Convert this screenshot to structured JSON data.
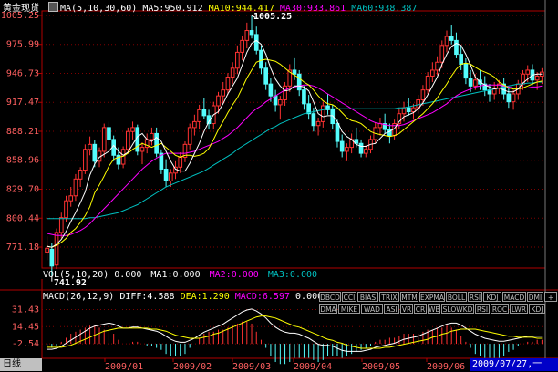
{
  "header": {
    "instrument": "黄金现货",
    "ma_params": "MA(5,10,30,60)",
    "ma5": "MA5:950.912",
    "ma10": "MA10:944.417",
    "ma30": "MA30:933.861",
    "ma60": "MA60:938.387"
  },
  "vol_header": {
    "params": "VOL(5,10,20) 0.000",
    "ma1": "MA1:0.000",
    "ma2": "MA2:0.000",
    "ma3": "MA3:0.000"
  },
  "macd_header": {
    "params": "MACD(26,12,9)",
    "diff": "DIFF:4.588",
    "dea": "DEA:1.290",
    "macd": "MACD:6.597",
    "zero": "0.000"
  },
  "indicator_buttons_row1": [
    "DBCD",
    "CCI",
    "BIAS",
    "TRIX",
    "MTM",
    "EXPMA",
    "BOLL",
    "RSI",
    "KDJ",
    "MACD",
    "DMI",
    "+"
  ],
  "indicator_buttons_row2": [
    "DMA",
    "MIKE",
    "WAD",
    "ASI",
    "VR",
    "CR",
    "WB",
    "SLOWKD",
    "RSI",
    "ROC",
    "LWR",
    "KDJ"
  ],
  "bottom": {
    "corner_label": "日线",
    "date_label": "2009/07/27,一"
  },
  "colors": {
    "up": "#ff3232",
    "down": "#54fcfc",
    "ma5": "#ffffff",
    "ma10": "#ffff00",
    "ma30": "#ff00ff",
    "ma60": "#00c0c0",
    "axis": "#b00000",
    "grid": "#800000"
  },
  "chart_data": {
    "type": "candlestick",
    "price_axis": {
      "ticks": [
        "1005.25",
        "975.99",
        "946.73",
        "917.47",
        "888.21",
        "858.96",
        "829.70",
        "800.44",
        "771.18"
      ],
      "ylim": [
        750,
        1008
      ]
    },
    "annotations": {
      "high": "1005.25",
      "low": "741.92"
    },
    "x_labels": [
      "2009/01",
      "2009/02",
      "2009/03",
      "2009/04",
      "2009/05",
      "2009/06"
    ],
    "macd_axis": {
      "ticks": [
        "31.43",
        "14.45",
        "-2.54"
      ]
    },
    "candles": [
      [
        766,
        782,
        758,
        770
      ],
      [
        769,
        775,
        742,
        752
      ],
      [
        753,
        790,
        749,
        786
      ],
      [
        786,
        806,
        780,
        801
      ],
      [
        801,
        823,
        797,
        818
      ],
      [
        818,
        832,
        812,
        823
      ],
      [
        823,
        845,
        818,
        840
      ],
      [
        840,
        852,
        832,
        849
      ],
      [
        849,
        875,
        845,
        870
      ],
      [
        870,
        883,
        864,
        875
      ],
      [
        875,
        879,
        852,
        858
      ],
      [
        858,
        872,
        852,
        868
      ],
      [
        868,
        896,
        862,
        892
      ],
      [
        892,
        898,
        874,
        880
      ],
      [
        880,
        884,
        858,
        864
      ],
      [
        864,
        872,
        850,
        855
      ],
      [
        855,
        873,
        851,
        870
      ],
      [
        870,
        892,
        866,
        888
      ],
      [
        888,
        898,
        880,
        892
      ],
      [
        892,
        895,
        864,
        868
      ],
      [
        868,
        877,
        855,
        872
      ],
      [
        872,
        886,
        866,
        880
      ],
      [
        880,
        892,
        874,
        886
      ],
      [
        886,
        892,
        862,
        866
      ],
      [
        866,
        870,
        845,
        850
      ],
      [
        850,
        860,
        832,
        838
      ],
      [
        838,
        850,
        832,
        846
      ],
      [
        846,
        858,
        840,
        852
      ],
      [
        852,
        867,
        846,
        862
      ],
      [
        862,
        878,
        857,
        875
      ],
      [
        875,
        896,
        870,
        892
      ],
      [
        892,
        905,
        884,
        898
      ],
      [
        898,
        915,
        890,
        910
      ],
      [
        910,
        922,
        901,
        904
      ],
      [
        904,
        910,
        890,
        896
      ],
      [
        896,
        918,
        890,
        914
      ],
      [
        914,
        928,
        906,
        924
      ],
      [
        924,
        938,
        916,
        930
      ],
      [
        930,
        947,
        925,
        943
      ],
      [
        943,
        958,
        936,
        952
      ],
      [
        952,
        975,
        946,
        968
      ],
      [
        968,
        985,
        960,
        980
      ],
      [
        980,
        998,
        972,
        990
      ],
      [
        990,
        1005,
        982,
        986
      ],
      [
        986,
        994,
        966,
        970
      ],
      [
        970,
        975,
        946,
        952
      ],
      [
        952,
        958,
        930,
        936
      ],
      [
        936,
        942,
        918,
        924
      ],
      [
        924,
        930,
        908,
        915
      ],
      [
        915,
        924,
        900,
        920
      ],
      [
        920,
        938,
        914,
        934
      ],
      [
        934,
        956,
        928,
        950
      ],
      [
        950,
        962,
        940,
        946
      ],
      [
        946,
        950,
        924,
        930
      ],
      [
        930,
        934,
        910,
        916
      ],
      [
        916,
        925,
        900,
        906
      ],
      [
        906,
        912,
        888,
        894
      ],
      [
        894,
        902,
        884,
        898
      ],
      [
        898,
        918,
        892,
        914
      ],
      [
        914,
        926,
        905,
        910
      ],
      [
        910,
        915,
        890,
        896
      ],
      [
        896,
        900,
        872,
        878
      ],
      [
        878,
        885,
        862,
        868
      ],
      [
        868,
        876,
        858,
        872
      ],
      [
        872,
        886,
        866,
        880
      ],
      [
        880,
        892,
        872,
        876
      ],
      [
        876,
        880,
        862,
        866
      ],
      [
        866,
        874,
        862,
        870
      ],
      [
        870,
        884,
        866,
        880
      ],
      [
        880,
        897,
        876,
        892
      ],
      [
        892,
        902,
        884,
        896
      ],
      [
        896,
        906,
        886,
        890
      ],
      [
        890,
        896,
        876,
        884
      ],
      [
        884,
        900,
        880,
        896
      ],
      [
        896,
        912,
        890,
        906
      ],
      [
        906,
        918,
        898,
        912
      ],
      [
        912,
        922,
        904,
        908
      ],
      [
        908,
        916,
        900,
        912
      ],
      [
        912,
        925,
        906,
        920
      ],
      [
        920,
        935,
        914,
        930
      ],
      [
        930,
        948,
        926,
        944
      ],
      [
        944,
        958,
        938,
        950
      ],
      [
        950,
        964,
        945,
        958
      ],
      [
        958,
        980,
        952,
        975
      ],
      [
        975,
        990,
        968,
        984
      ],
      [
        984,
        996,
        976,
        980
      ],
      [
        980,
        988,
        962,
        966
      ],
      [
        966,
        975,
        950,
        956
      ],
      [
        956,
        962,
        936,
        942
      ],
      [
        942,
        950,
        928,
        934
      ],
      [
        934,
        946,
        930,
        940
      ],
      [
        940,
        950,
        930,
        936
      ],
      [
        936,
        944,
        924,
        930
      ],
      [
        930,
        936,
        918,
        926
      ],
      [
        926,
        938,
        920,
        932
      ],
      [
        932,
        940,
        926,
        936
      ],
      [
        936,
        942,
        920,
        926
      ],
      [
        926,
        932,
        912,
        918
      ],
      [
        918,
        930,
        910,
        926
      ],
      [
        926,
        940,
        920,
        936
      ],
      [
        936,
        950,
        930,
        946
      ],
      [
        946,
        955,
        938,
        950
      ],
      [
        950,
        956,
        935,
        940
      ],
      [
        940,
        948,
        930,
        944
      ],
      [
        944,
        952,
        936,
        948
      ]
    ],
    "ma5": [
      772,
      771,
      774,
      779,
      787,
      797,
      806,
      816,
      827,
      844,
      855,
      862,
      865,
      868,
      874,
      868,
      864,
      867,
      875,
      883,
      886,
      880,
      878,
      882,
      878,
      868,
      858,
      850,
      848,
      848,
      856,
      866,
      876,
      888,
      898,
      905,
      908,
      916,
      926,
      934,
      942,
      955,
      968,
      977,
      980,
      976,
      966,
      952,
      941,
      934,
      929,
      930,
      934,
      934,
      933,
      929,
      918,
      906,
      903,
      904,
      904,
      898,
      888,
      883,
      880,
      875,
      873,
      873,
      875,
      876,
      881,
      886,
      888,
      891,
      898,
      903,
      905,
      907,
      911,
      917,
      925,
      934,
      943,
      956,
      966,
      974,
      977,
      975,
      966,
      955,
      943,
      938,
      935,
      933,
      931,
      932,
      930,
      928,
      928,
      931,
      937,
      941,
      945,
      946,
      946
    ],
    "ma10": [
      772,
      771,
      773,
      776,
      780,
      786,
      790,
      796,
      803,
      812,
      826,
      834,
      843,
      853,
      860,
      862,
      863,
      866,
      870,
      873,
      876,
      874,
      872,
      874,
      876,
      872,
      868,
      864,
      862,
      864,
      864,
      863,
      864,
      866,
      871,
      880,
      890,
      898,
      907,
      915,
      922,
      932,
      942,
      950,
      958,
      960,
      961,
      960,
      959,
      956,
      952,
      948,
      945,
      942,
      938,
      935,
      930,
      924,
      919,
      916,
      915,
      912,
      907,
      902,
      899,
      898,
      896,
      892,
      888,
      886,
      885,
      884,
      883,
      884,
      886,
      890,
      894,
      898,
      902,
      906,
      911,
      916,
      922,
      929,
      936,
      944,
      951,
      956,
      957,
      956,
      953,
      950,
      948,
      946,
      943,
      938,
      935,
      932,
      931,
      931,
      932,
      934,
      936,
      938,
      939
    ],
    "ma30": [
      785,
      784,
      783,
      783,
      783,
      784,
      786,
      788,
      791,
      795,
      800,
      805,
      810,
      815,
      820,
      825,
      830,
      835,
      840,
      845,
      850,
      854,
      858,
      861,
      864,
      866,
      866,
      866,
      866,
      866,
      867,
      868,
      870,
      872,
      874,
      876,
      878,
      881,
      884,
      888,
      892,
      897,
      902,
      907,
      911,
      914,
      918,
      921,
      924,
      927,
      930,
      932,
      933,
      934,
      935,
      935,
      934,
      932,
      929,
      926,
      923,
      920,
      917,
      914,
      911,
      908,
      905,
      902,
      899,
      897,
      896,
      895,
      894,
      894,
      894,
      895,
      897,
      899,
      901,
      903,
      905,
      907,
      910,
      913,
      916,
      920,
      924,
      927,
      929,
      931,
      933,
      934,
      935,
      935,
      935,
      935,
      934,
      933,
      932,
      932,
      932,
      932,
      933,
      933,
      934
    ],
    "ma60": [
      800,
      800,
      800,
      800,
      800,
      800,
      800,
      800,
      800,
      801,
      801,
      802,
      803,
      804,
      805,
      806,
      808,
      810,
      812,
      814,
      817,
      820,
      823,
      826,
      829,
      832,
      834,
      836,
      838,
      840,
      842,
      844,
      846,
      848,
      851,
      854,
      857,
      860,
      863,
      866,
      870,
      873,
      876,
      879,
      882,
      885,
      888,
      891,
      893,
      896,
      898,
      900,
      902,
      904,
      906,
      907,
      908,
      909,
      910,
      911,
      911,
      911,
      911,
      911,
      911,
      911,
      911,
      911,
      911,
      911,
      911,
      911,
      911,
      911,
      912,
      912,
      913,
      914,
      915,
      916,
      917,
      918,
      919,
      920,
      921,
      922,
      923,
      924,
      925,
      926,
      927,
      928,
      929,
      930,
      931,
      932,
      933,
      934,
      935,
      936,
      936,
      937,
      937,
      938,
      938
    ],
    "macd_diff": [
      -8,
      -8,
      -7,
      -5,
      -2,
      1,
      4,
      7,
      10,
      13,
      15,
      16,
      17,
      18,
      17,
      15,
      13,
      13,
      14,
      14,
      13,
      12,
      11,
      10,
      8,
      5,
      2,
      0,
      -1,
      -1,
      1,
      3,
      6,
      9,
      11,
      13,
      15,
      17,
      20,
      23,
      26,
      29,
      31,
      32,
      30,
      27,
      23,
      18,
      14,
      11,
      9,
      8,
      8,
      7,
      5,
      3,
      0,
      -3,
      -4,
      -4,
      -5,
      -7,
      -9,
      -10,
      -10,
      -10,
      -10,
      -9,
      -8,
      -6,
      -5,
      -4,
      -3,
      -2,
      0,
      2,
      3,
      4,
      5,
      7,
      9,
      11,
      13,
      15,
      17,
      18,
      18,
      16,
      13,
      10,
      7,
      5,
      3,
      2,
      1,
      0,
      0,
      1,
      2,
      3,
      4,
      5,
      5,
      5,
      5
    ],
    "macd_dea": [
      -6,
      -6,
      -6,
      -6,
      -5,
      -4,
      -2,
      0,
      2,
      4,
      6,
      8,
      10,
      11,
      12,
      13,
      13,
      13,
      13,
      13,
      13,
      13,
      12,
      12,
      11,
      10,
      8,
      6,
      5,
      4,
      3,
      3,
      3,
      4,
      5,
      7,
      8,
      10,
      12,
      14,
      16,
      18,
      20,
      22,
      24,
      25,
      25,
      24,
      23,
      21,
      19,
      17,
      15,
      14,
      12,
      10,
      8,
      6,
      4,
      2,
      1,
      -1,
      -2,
      -4,
      -5,
      -6,
      -7,
      -7,
      -7,
      -7,
      -7,
      -6,
      -6,
      -5,
      -4,
      -3,
      -2,
      -1,
      0,
      1,
      2,
      4,
      5,
      7,
      8,
      10,
      11,
      12,
      12,
      12,
      12,
      11,
      10,
      9,
      8,
      7,
      6,
      5,
      5,
      4,
      4,
      4,
      4,
      3,
      3
    ],
    "volume": []
  }
}
